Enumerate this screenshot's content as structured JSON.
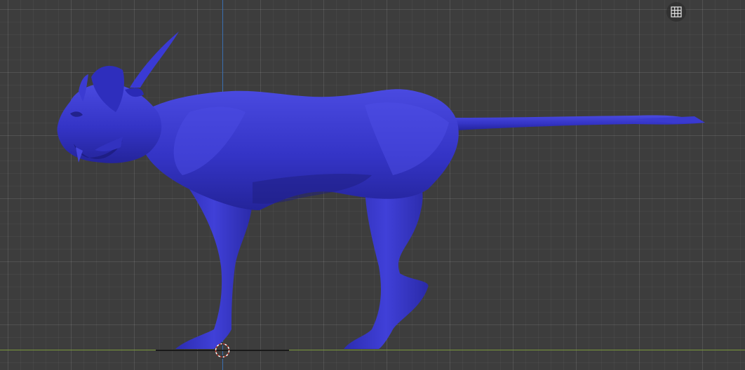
{
  "viewport": {
    "background": "#3d3d3d",
    "axis_colors": {
      "vertical": "#3a6fb0",
      "horizontal": "#7b9a3a"
    },
    "model": {
      "object": "cat-creature",
      "color": "#3636c8",
      "shade_color": "#1f1f8a",
      "highlight_color": "#5a5ae6"
    },
    "cursor_colors": [
      "#ffffff",
      "#c0392b"
    ]
  },
  "overlay": {
    "grid_toggle_icon": "grid-icon"
  }
}
